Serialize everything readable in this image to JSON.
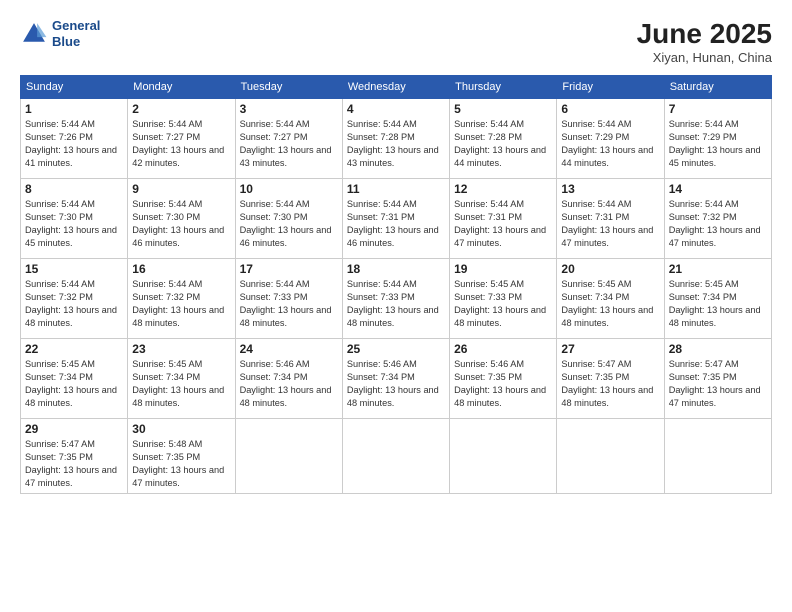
{
  "header": {
    "logo_line1": "General",
    "logo_line2": "Blue",
    "month": "June 2025",
    "location": "Xiyan, Hunan, China"
  },
  "days_of_week": [
    "Sunday",
    "Monday",
    "Tuesday",
    "Wednesday",
    "Thursday",
    "Friday",
    "Saturday"
  ],
  "weeks": [
    [
      {
        "day": "1",
        "sunrise": "Sunrise: 5:44 AM",
        "sunset": "Sunset: 7:26 PM",
        "daylight": "Daylight: 13 hours and 41 minutes."
      },
      {
        "day": "2",
        "sunrise": "Sunrise: 5:44 AM",
        "sunset": "Sunset: 7:27 PM",
        "daylight": "Daylight: 13 hours and 42 minutes."
      },
      {
        "day": "3",
        "sunrise": "Sunrise: 5:44 AM",
        "sunset": "Sunset: 7:27 PM",
        "daylight": "Daylight: 13 hours and 43 minutes."
      },
      {
        "day": "4",
        "sunrise": "Sunrise: 5:44 AM",
        "sunset": "Sunset: 7:28 PM",
        "daylight": "Daylight: 13 hours and 43 minutes."
      },
      {
        "day": "5",
        "sunrise": "Sunrise: 5:44 AM",
        "sunset": "Sunset: 7:28 PM",
        "daylight": "Daylight: 13 hours and 44 minutes."
      },
      {
        "day": "6",
        "sunrise": "Sunrise: 5:44 AM",
        "sunset": "Sunset: 7:29 PM",
        "daylight": "Daylight: 13 hours and 44 minutes."
      },
      {
        "day": "7",
        "sunrise": "Sunrise: 5:44 AM",
        "sunset": "Sunset: 7:29 PM",
        "daylight": "Daylight: 13 hours and 45 minutes."
      }
    ],
    [
      {
        "day": "8",
        "sunrise": "Sunrise: 5:44 AM",
        "sunset": "Sunset: 7:30 PM",
        "daylight": "Daylight: 13 hours and 45 minutes."
      },
      {
        "day": "9",
        "sunrise": "Sunrise: 5:44 AM",
        "sunset": "Sunset: 7:30 PM",
        "daylight": "Daylight: 13 hours and 46 minutes."
      },
      {
        "day": "10",
        "sunrise": "Sunrise: 5:44 AM",
        "sunset": "Sunset: 7:30 PM",
        "daylight": "Daylight: 13 hours and 46 minutes."
      },
      {
        "day": "11",
        "sunrise": "Sunrise: 5:44 AM",
        "sunset": "Sunset: 7:31 PM",
        "daylight": "Daylight: 13 hours and 46 minutes."
      },
      {
        "day": "12",
        "sunrise": "Sunrise: 5:44 AM",
        "sunset": "Sunset: 7:31 PM",
        "daylight": "Daylight: 13 hours and 47 minutes."
      },
      {
        "day": "13",
        "sunrise": "Sunrise: 5:44 AM",
        "sunset": "Sunset: 7:31 PM",
        "daylight": "Daylight: 13 hours and 47 minutes."
      },
      {
        "day": "14",
        "sunrise": "Sunrise: 5:44 AM",
        "sunset": "Sunset: 7:32 PM",
        "daylight": "Daylight: 13 hours and 47 minutes."
      }
    ],
    [
      {
        "day": "15",
        "sunrise": "Sunrise: 5:44 AM",
        "sunset": "Sunset: 7:32 PM",
        "daylight": "Daylight: 13 hours and 48 minutes."
      },
      {
        "day": "16",
        "sunrise": "Sunrise: 5:44 AM",
        "sunset": "Sunset: 7:32 PM",
        "daylight": "Daylight: 13 hours and 48 minutes."
      },
      {
        "day": "17",
        "sunrise": "Sunrise: 5:44 AM",
        "sunset": "Sunset: 7:33 PM",
        "daylight": "Daylight: 13 hours and 48 minutes."
      },
      {
        "day": "18",
        "sunrise": "Sunrise: 5:44 AM",
        "sunset": "Sunset: 7:33 PM",
        "daylight": "Daylight: 13 hours and 48 minutes."
      },
      {
        "day": "19",
        "sunrise": "Sunrise: 5:45 AM",
        "sunset": "Sunset: 7:33 PM",
        "daylight": "Daylight: 13 hours and 48 minutes."
      },
      {
        "day": "20",
        "sunrise": "Sunrise: 5:45 AM",
        "sunset": "Sunset: 7:34 PM",
        "daylight": "Daylight: 13 hours and 48 minutes."
      },
      {
        "day": "21",
        "sunrise": "Sunrise: 5:45 AM",
        "sunset": "Sunset: 7:34 PM",
        "daylight": "Daylight: 13 hours and 48 minutes."
      }
    ],
    [
      {
        "day": "22",
        "sunrise": "Sunrise: 5:45 AM",
        "sunset": "Sunset: 7:34 PM",
        "daylight": "Daylight: 13 hours and 48 minutes."
      },
      {
        "day": "23",
        "sunrise": "Sunrise: 5:45 AM",
        "sunset": "Sunset: 7:34 PM",
        "daylight": "Daylight: 13 hours and 48 minutes."
      },
      {
        "day": "24",
        "sunrise": "Sunrise: 5:46 AM",
        "sunset": "Sunset: 7:34 PM",
        "daylight": "Daylight: 13 hours and 48 minutes."
      },
      {
        "day": "25",
        "sunrise": "Sunrise: 5:46 AM",
        "sunset": "Sunset: 7:34 PM",
        "daylight": "Daylight: 13 hours and 48 minutes."
      },
      {
        "day": "26",
        "sunrise": "Sunrise: 5:46 AM",
        "sunset": "Sunset: 7:35 PM",
        "daylight": "Daylight: 13 hours and 48 minutes."
      },
      {
        "day": "27",
        "sunrise": "Sunrise: 5:47 AM",
        "sunset": "Sunset: 7:35 PM",
        "daylight": "Daylight: 13 hours and 48 minutes."
      },
      {
        "day": "28",
        "sunrise": "Sunrise: 5:47 AM",
        "sunset": "Sunset: 7:35 PM",
        "daylight": "Daylight: 13 hours and 47 minutes."
      }
    ],
    [
      {
        "day": "29",
        "sunrise": "Sunrise: 5:47 AM",
        "sunset": "Sunset: 7:35 PM",
        "daylight": "Daylight: 13 hours and 47 minutes."
      },
      {
        "day": "30",
        "sunrise": "Sunrise: 5:48 AM",
        "sunset": "Sunset: 7:35 PM",
        "daylight": "Daylight: 13 hours and 47 minutes."
      },
      null,
      null,
      null,
      null,
      null
    ]
  ]
}
